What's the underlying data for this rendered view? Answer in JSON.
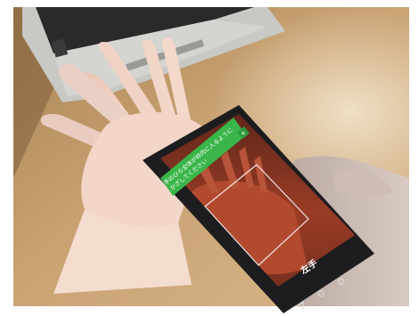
{
  "photo": {
    "banner": {
      "line1": "手のひら全体が枠内に入るように",
      "line2": "かざしてください",
      "close_glyph": "✕",
      "color": "#39b54a"
    },
    "hand_label": "左手",
    "nav": {
      "back_icon": "triangle-back",
      "home_icon": "circle-home",
      "recents_icon": "square-recents"
    },
    "colors": {
      "table": "#c9a273",
      "skin": "#f0c8b4",
      "phone": "#1d1d1f",
      "screen_bg": "#8c3424"
    }
  }
}
